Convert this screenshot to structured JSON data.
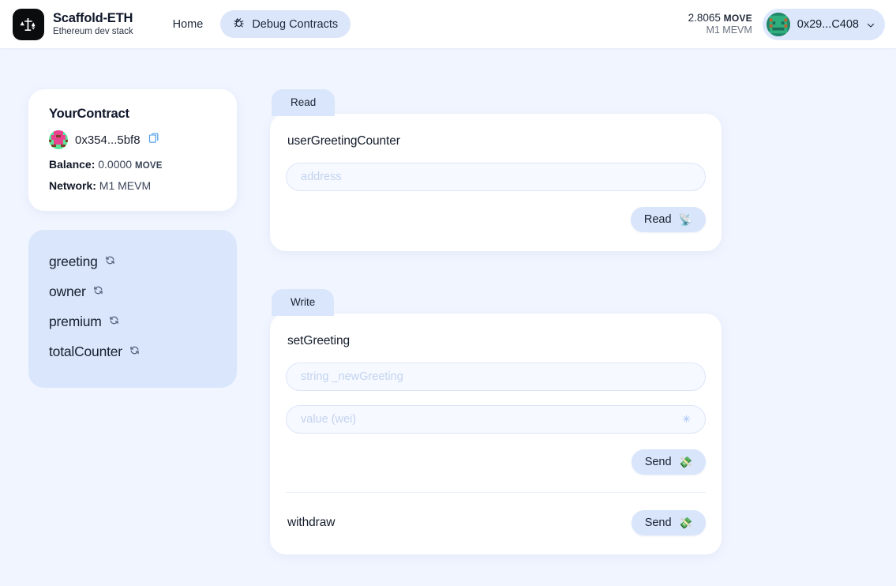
{
  "header": {
    "brand": {
      "title": "Scaffold-ETH",
      "subtitle": "Ethereum dev stack",
      "logo_icon": "scaffold-eth-logo-icon"
    },
    "nav": [
      {
        "label": "Home",
        "active": false,
        "icon": null
      },
      {
        "label": "Debug Contracts",
        "active": true,
        "icon": "bug-icon"
      }
    ],
    "balance": {
      "amount": "2.8065",
      "symbol": "MOVE",
      "network": "M1 MEVM"
    },
    "account": {
      "address": "0x29...C408",
      "avatar": "account-blockie-avatar",
      "chevron": "chevron-down-icon"
    }
  },
  "sidebar": {
    "contract": {
      "name": "YourContract",
      "address": "0x354...5bf8",
      "avatar": "contract-blockie-avatar",
      "copy_icon": "copy-icon",
      "balance_label": "Balance:",
      "balance_value": "0.0000",
      "balance_unit": "MOVE",
      "network_label": "Network:",
      "network_value": "M1 MEVM"
    },
    "variables": [
      {
        "name": "greeting",
        "refresh_icon": "refresh-icon"
      },
      {
        "name": "owner",
        "refresh_icon": "refresh-icon"
      },
      {
        "name": "premium",
        "refresh_icon": "refresh-icon"
      },
      {
        "name": "totalCounter",
        "refresh_icon": "refresh-icon"
      }
    ]
  },
  "read_section": {
    "tab_label": "Read",
    "function_name": "userGreetingCounter",
    "input_placeholder": "address",
    "button_label": "Read",
    "button_icon": "satellite-antenna-icon"
  },
  "write_section": {
    "tab_label": "Write",
    "functions": [
      {
        "name": "setGreeting",
        "inputs": [
          {
            "placeholder": "string _newGreeting",
            "star": ""
          },
          {
            "placeholder": "value (wei)",
            "star": "✳"
          }
        ],
        "button_label": "Send",
        "button_icon": "money-with-wings-icon"
      },
      {
        "name": "withdraw",
        "inputs": [],
        "button_label": "Send",
        "button_icon": "money-with-wings-icon"
      }
    ]
  },
  "colors": {
    "page_bg": "#f1f5ff",
    "accent_blue": "#d8e5fb",
    "card_white": "#ffffff",
    "text_dark": "#0f172a"
  }
}
